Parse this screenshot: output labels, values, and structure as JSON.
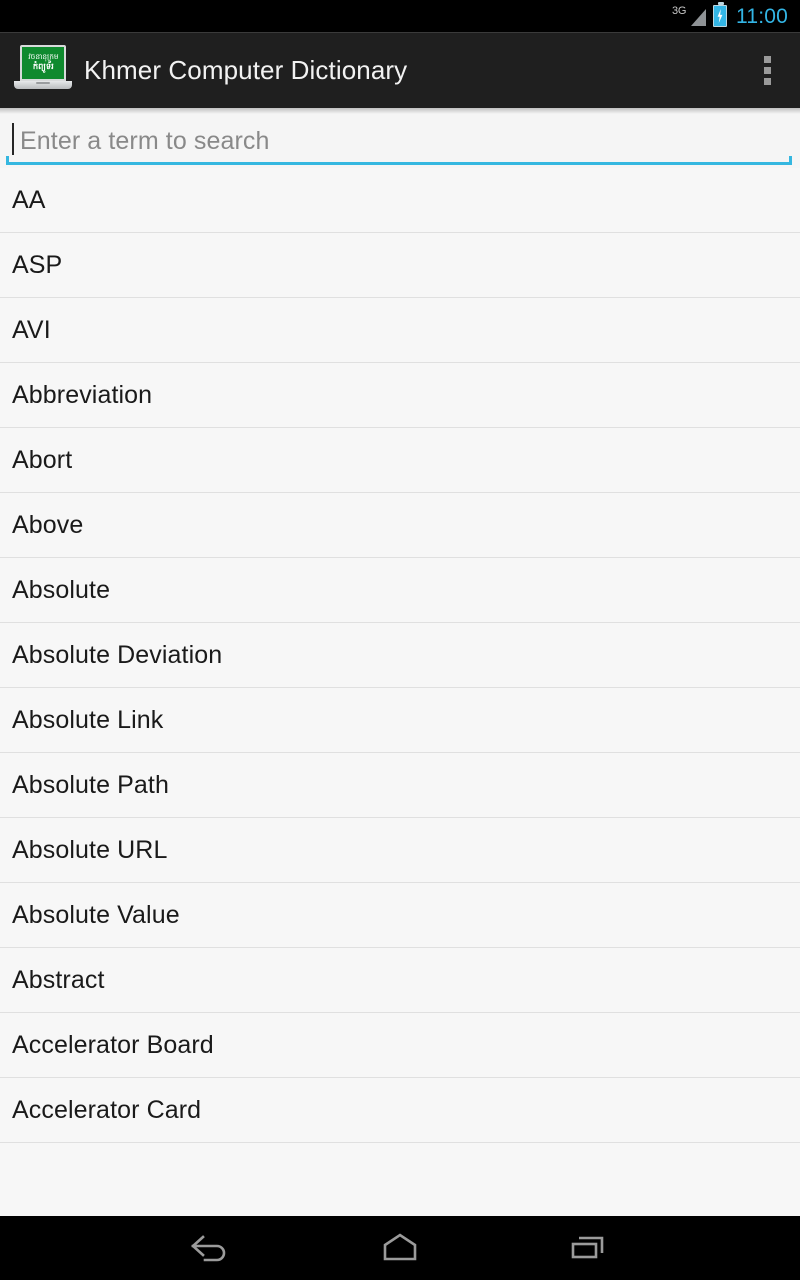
{
  "status_bar": {
    "network_type": "3G",
    "battery_icon": "battery-charging-icon",
    "signal_icon": "signal-triangle-icon",
    "time": "11:00",
    "time_color": "#33b5e5"
  },
  "action_bar": {
    "app_icon": "khmer-dictionary-laptop-icon",
    "icon_text_line1": "វចនានុក្រម",
    "icon_text_line2": "កំព្យូទ័រ",
    "title": "Khmer Computer Dictionary",
    "overflow_icon": "overflow-menu-icon",
    "background": "#1f1f1f"
  },
  "search": {
    "placeholder": "Enter a term to search",
    "value": "",
    "accent_color": "#35b7e0"
  },
  "list": {
    "items": [
      {
        "term": "AA"
      },
      {
        "term": "ASP"
      },
      {
        "term": "AVI"
      },
      {
        "term": "Abbreviation"
      },
      {
        "term": "Abort"
      },
      {
        "term": "Above"
      },
      {
        "term": "Absolute"
      },
      {
        "term": "Absolute Deviation"
      },
      {
        "term": "Absolute Link"
      },
      {
        "term": "Absolute Path"
      },
      {
        "term": "Absolute URL"
      },
      {
        "term": "Absolute Value"
      },
      {
        "term": "Abstract"
      },
      {
        "term": "Accelerator Board"
      },
      {
        "term": "Accelerator Card"
      }
    ]
  },
  "nav_bar": {
    "back_icon": "back-arrow-icon",
    "home_icon": "home-icon",
    "recents_icon": "recents-icon"
  }
}
